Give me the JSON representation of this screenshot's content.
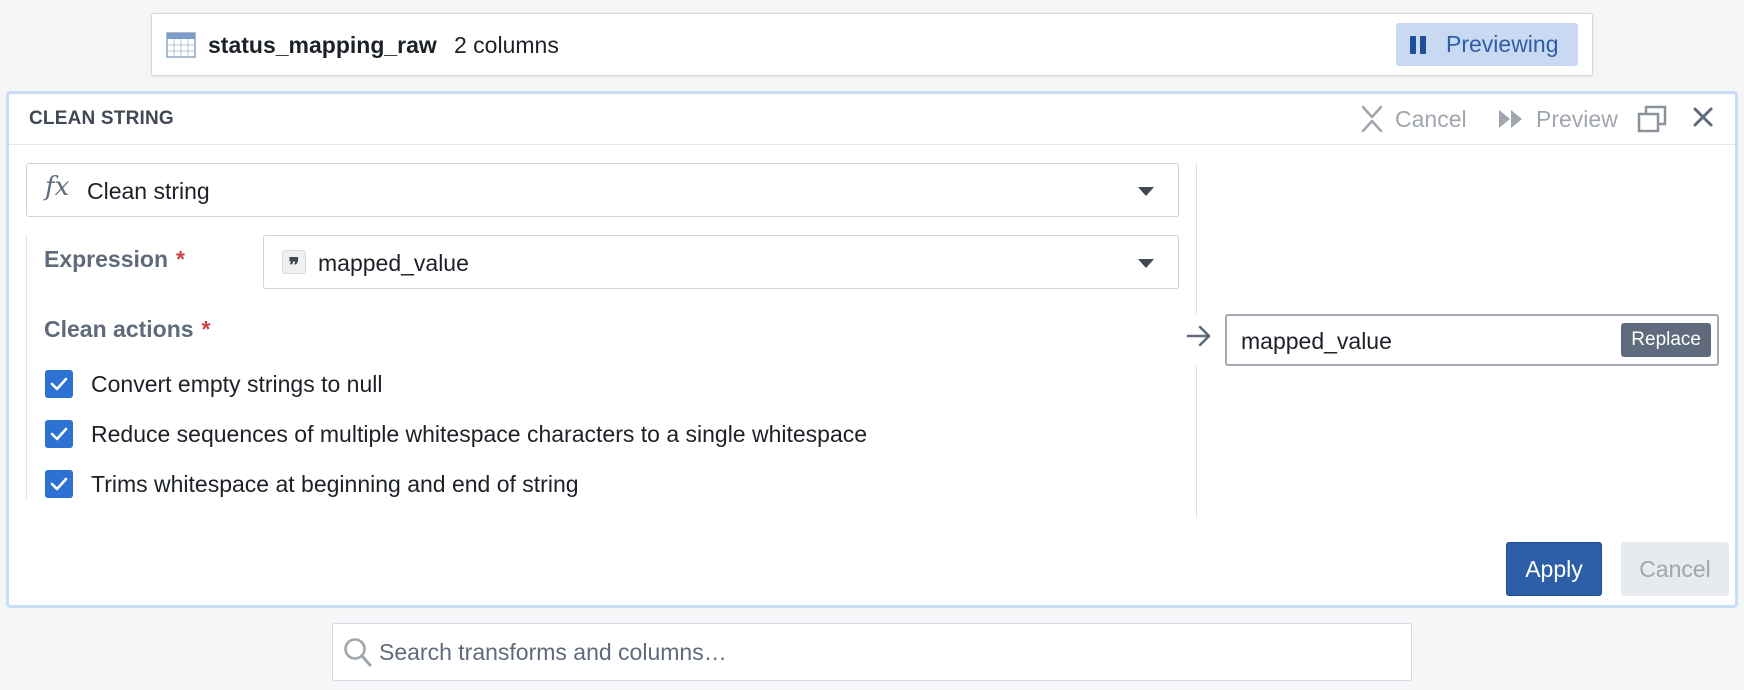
{
  "dataset": {
    "name": "status_mapping_raw",
    "columns_label": "2 columns",
    "previewing_label": "Previewing"
  },
  "panel": {
    "title": "CLEAN STRING",
    "header_actions": {
      "cancel_label": "Cancel",
      "preview_label": "Preview"
    },
    "function": {
      "icon": "fx-icon",
      "label": "Clean string"
    },
    "expression": {
      "label": "Expression",
      "required_mark": "*",
      "value": "mapped_value"
    },
    "clean_actions": {
      "label": "Clean actions",
      "required_mark": "*",
      "options": [
        {
          "label": "Convert empty strings to null",
          "checked": true
        },
        {
          "label": "Reduce sequences of multiple whitespace characters to a single whitespace",
          "checked": true
        },
        {
          "label": "Trims whitespace at beginning and end of string",
          "checked": true
        }
      ]
    },
    "output": {
      "value": "mapped_value",
      "mode_label": "Replace"
    },
    "footer": {
      "apply_label": "Apply",
      "cancel_label": "Cancel"
    }
  },
  "search": {
    "placeholder": "Search transforms and columns…"
  },
  "colors": {
    "accent": "#2d72d2",
    "apply": "#2d5ea8",
    "panel_border": "#c9dcf3",
    "required": "#cd4246"
  }
}
